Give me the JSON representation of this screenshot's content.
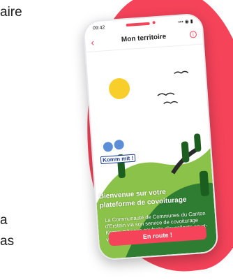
{
  "slide": {
    "text_fragments": [
      "aire",
      "a",
      "as"
    ]
  },
  "status_bar": {
    "time": "09:42",
    "indicators": "••• ◉ ▮"
  },
  "header": {
    "title": "Mon territoire",
    "back_icon": "chevron-left-icon",
    "info_icon": "info-icon",
    "info_glyph": "i"
  },
  "logo": {
    "text": "Komm mit !"
  },
  "welcome": {
    "title": "Bienvenue sur votre plateforme de covoiturage",
    "description": "La Communauté de Communes du Canton d'Erstein via son service de covoiturage Komm mit vous souhaite d'excellents court-voiturages sur Karos"
  },
  "cta": {
    "label": "En route !"
  },
  "colors": {
    "accent": "#f5435a",
    "sky": "#ffffff",
    "sun": "#f8cf2a",
    "hill_light": "#8bc34a",
    "hill_dark": "#2e7d32",
    "road": "#2a2a2a"
  }
}
